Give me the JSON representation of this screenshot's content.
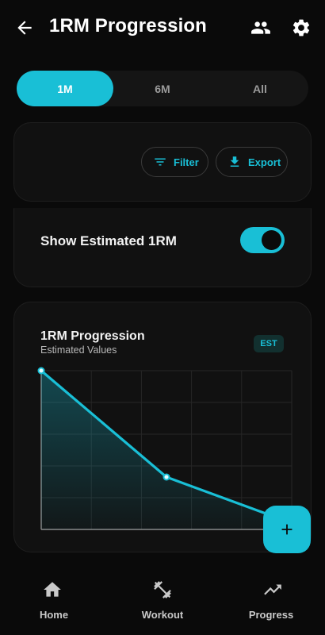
{
  "header": {
    "title": "1RM Progression",
    "back_icon": "arrow-left-icon",
    "people_icon": "people-icon",
    "settings_icon": "gear-icon"
  },
  "range_tabs": [
    {
      "label": "1M",
      "active": true
    },
    {
      "label": "6M",
      "active": false
    },
    {
      "label": "All",
      "active": false
    }
  ],
  "filters_card": {
    "filter_label": "Filter",
    "export_label": "Export"
  },
  "toggle_card": {
    "label": "Show Estimated 1RM",
    "enabled": true
  },
  "chart_card": {
    "title": "1RM Progression",
    "subtitle": "Estimated Values",
    "badge": "EST"
  },
  "chart_data": {
    "type": "area",
    "title": "1RM Progression",
    "subtitle": "Estimated Values",
    "xlabel": "",
    "ylabel": "",
    "x": [
      0,
      1,
      2
    ],
    "ylim": [
      0,
      1
    ],
    "series": [
      {
        "values": [
          1.0,
          0.33,
          0.04
        ]
      }
    ],
    "grid": true,
    "show_tick_labels": false
  },
  "fab": {
    "icon": "plus-icon"
  },
  "bottom_nav": [
    {
      "label": "Home",
      "icon": "home-icon"
    },
    {
      "label": "Workout",
      "icon": "dumbbell-icon"
    },
    {
      "label": "Progress",
      "icon": "trending-up-icon"
    }
  ],
  "colors": {
    "accent": "#19bfd6",
    "background": "#0a0a0a",
    "card": "#111111"
  }
}
